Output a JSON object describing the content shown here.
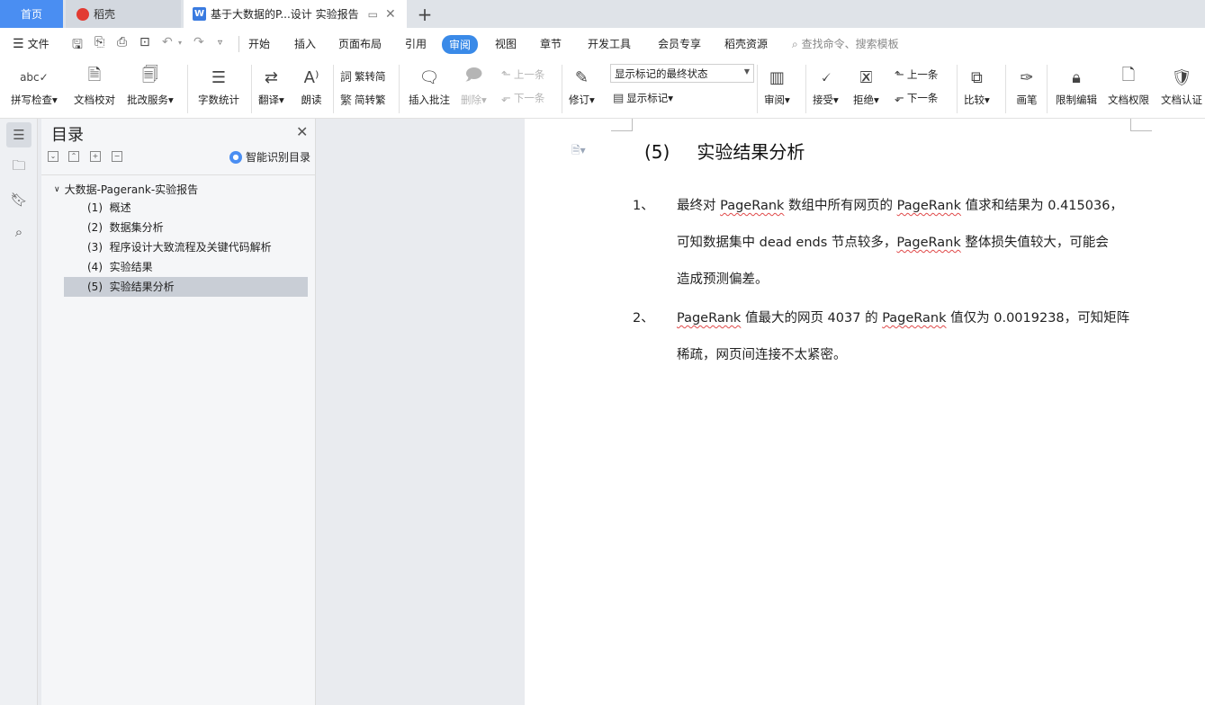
{
  "tabs": {
    "home": "首页",
    "daoke": "稻壳",
    "doc": "基于大数据的P...设计 实验报告",
    "doc_logo": "W"
  },
  "menu": {
    "file": "文件",
    "tabs": [
      "开始",
      "插入",
      "页面布局",
      "引用",
      "审阅",
      "视图",
      "章节",
      "开发工具",
      "会员专享",
      "稻壳资源"
    ],
    "active_tab": "审阅",
    "search_placeholder": "查找命令、搜索模板"
  },
  "ribbon": {
    "spell_check": "拼写检查",
    "doc_proof": "文档校对",
    "revise_service": "批改服务",
    "word_count": "字数统计",
    "translate": "翻译",
    "read_aloud": "朗读",
    "trad_to_simp": "繁转简",
    "simp_to_trad": "简转繁",
    "insert_comment": "插入批注",
    "delete_comment": "删除",
    "prev_comment": "上一条",
    "next_comment": "下一条",
    "track_changes": "修订",
    "markup_state": "显示标记的最终状态",
    "show_markup": "显示标记",
    "review_pane": "审阅",
    "accept": "接受",
    "reject": "拒绝",
    "prev_change": "上一条",
    "next_change": "下一条",
    "compare": "比较",
    "pen": "画笔",
    "restrict_edit": "限制编辑",
    "doc_permission": "文档权限",
    "doc_cert": "文档认证"
  },
  "outline": {
    "title": "目录",
    "smart_label": "智能识别目录",
    "root": "大数据-Pagerank-实验报告",
    "items": [
      {
        "num": "(1)",
        "label": "概述"
      },
      {
        "num": "(2)",
        "label": "数据集分析"
      },
      {
        "num": "(3)",
        "label": "程序设计大致流程及关键代码解析"
      },
      {
        "num": "(4)",
        "label": "实验结果"
      },
      {
        "num": "(5)",
        "label": "实验结果分析"
      }
    ],
    "selected_index": 4
  },
  "document": {
    "heading_num": "(5)",
    "heading_text": "实验结果分析",
    "items": [
      {
        "num": "1、",
        "line1": [
          "最终对 ",
          "PageRank",
          " 数组中所有网页的 ",
          "PageRank",
          " 值求和结果为 0.415036，"
        ],
        "line2": [
          "可知数据集中 dead ends 节点较多，",
          "PageRank",
          " 整体损失值较大，可能会"
        ],
        "line3": "造成预测偏差。"
      },
      {
        "num": "2、",
        "line1": [
          "PageRank",
          " 值最大的网页 4037 的 ",
          "PageRank",
          " 值仅为 0.0019238，可知矩阵"
        ],
        "line2": "稀疏，网页间连接不太紧密。"
      }
    ]
  },
  "colors": {
    "accent": "#3a8ae8",
    "home_tab": "#4a8ef2",
    "spell_underline": "#e04a4a"
  }
}
